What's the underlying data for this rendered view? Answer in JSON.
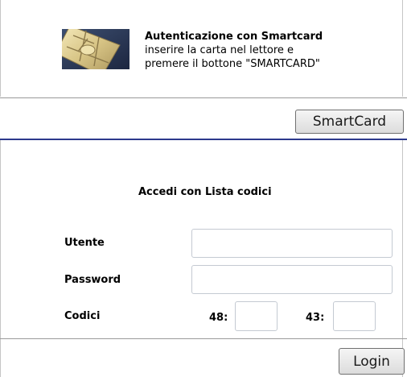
{
  "smartcard": {
    "title": "Autenticazione con Smartcard",
    "line1": "inserire la carta nel lettore e",
    "line2": "premere il bottone \"SMARTCARD\"",
    "button_label": "SmartCard",
    "card_icon": "smartcard-chip-icon"
  },
  "codes": {
    "title": "Accedi con Lista codici",
    "user_label": "Utente",
    "password_label": "Password",
    "codes_label": "Codici",
    "user_value": "",
    "password_value": "",
    "code1_number": "48:",
    "code1_value": "",
    "code2_number": "43:",
    "code2_value": "",
    "login_label": "Login"
  },
  "colors": {
    "separator_blue": "#2d3a8c",
    "separator_gray": "#9a9a9a"
  }
}
